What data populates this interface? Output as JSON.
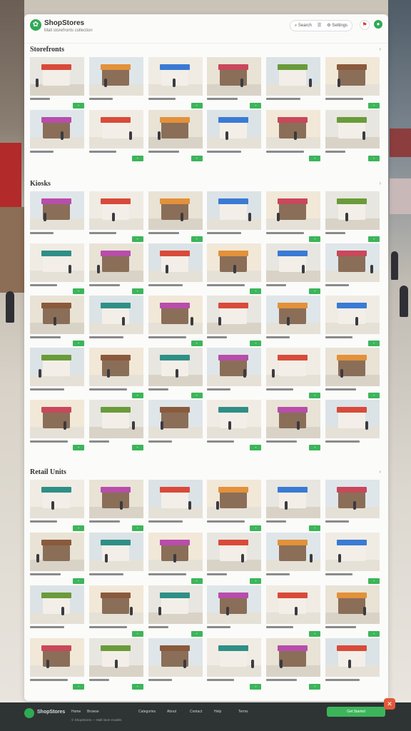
{
  "header": {
    "brand": "ShopStores",
    "tagline": "Mall storefronts collection",
    "tools": [
      "⌕ Search",
      "☰",
      "⚙ Settings"
    ]
  },
  "sections": [
    {
      "title": "Storefronts",
      "rows": 2
    },
    {
      "title": "Kiosks",
      "rows": 5
    },
    {
      "title": "Retail Units",
      "rows": 4
    }
  ],
  "footer": {
    "brand": "ShopStores",
    "links": [
      "Home",
      "Browse",
      "Categories",
      "About",
      "Contact",
      "Help",
      "Terms"
    ],
    "sub": "© ShopStores — Mall store models",
    "cta": "Get Started"
  },
  "colors": {
    "accent": "#3cb55a",
    "shop_palette": [
      "#d94a3a",
      "#e3913a",
      "#3a7bd5",
      "#c9485b",
      "#6a9b3a",
      "#8a5a3c",
      "#2f8f86",
      "#b84dab"
    ],
    "bg_palette": [
      "#e8e6e0",
      "#dfe6ea",
      "#f0ece4",
      "#e9e3d6",
      "#dbe3e6",
      "#f2e8d8"
    ]
  },
  "icons": {
    "logo": "leaf-icon",
    "close": "close-icon",
    "flag": "flag-icon"
  }
}
